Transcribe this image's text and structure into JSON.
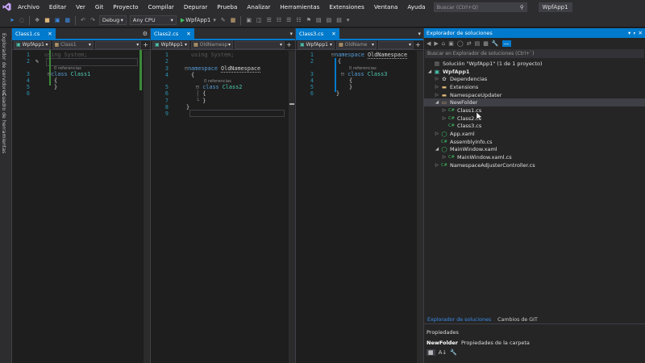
{
  "menu": {
    "items": [
      "Archivo",
      "Editar",
      "Ver",
      "Git",
      "Proyecto",
      "Compilar",
      "Depurar",
      "Prueba",
      "Analizar",
      "Herramientas",
      "Extensiones",
      "Ventana",
      "Ayuda"
    ],
    "search_placeholder": "Buscar (Ctrl+Q)",
    "app_title": "WpfApp1"
  },
  "toolbar": {
    "config": "Debug",
    "platform": "Any CPU",
    "run_target": "WpfApp1"
  },
  "left_strip": {
    "items": [
      "Explorador de servidores",
      "Cuadro de herramientas"
    ]
  },
  "editors": [
    {
      "tab": "Class1.cs",
      "project": "WpfApp1",
      "member": "Class1",
      "lines": [
        {
          "n": "1",
          "code": "using System;"
        },
        {
          "n": "2",
          "code": ""
        },
        {
          "n": "3",
          "ref": "0 referencias",
          "code": "class Class1"
        },
        {
          "n": "4",
          "code": "{"
        },
        {
          "n": "5",
          "code": "}"
        },
        {
          "n": "6",
          "code": ""
        }
      ]
    },
    {
      "tab": "Class2.cs",
      "project": "WpfApp1",
      "member": "OldNamesp",
      "lines": [
        {
          "n": "1",
          "code": "using System;"
        },
        {
          "n": "2",
          "code": ""
        },
        {
          "n": "3",
          "code": "namespace OldNamespace"
        },
        {
          "n": "4",
          "code": "{"
        },
        {
          "n": "5",
          "ref": "0 referencias",
          "code": "class Class2"
        },
        {
          "n": "6",
          "code": "{"
        },
        {
          "n": "7",
          "code": "}"
        },
        {
          "n": "8",
          "code": "}"
        },
        {
          "n": "9",
          "code": ""
        }
      ]
    },
    {
      "tab": "Class3.cs",
      "project": "WpfApp1",
      "member": "OldName",
      "lines": [
        {
          "n": "1",
          "code": "namespace OldNamespace"
        },
        {
          "n": "2",
          "code": "{"
        },
        {
          "n": "3",
          "ref": "0 referencias",
          "code": "class Class3"
        },
        {
          "n": "4",
          "code": "{"
        },
        {
          "n": "5",
          "code": "}"
        },
        {
          "n": "6",
          "code": "}"
        }
      ]
    }
  ],
  "solution_explorer": {
    "title": "Explorador de soluciones",
    "search_placeholder": "Buscar en Explorador de soluciones (Ctrl+`)",
    "tree": [
      {
        "label": "Solución \"WpfApp1\" (1 de 1 proyecto)",
        "depth": 0,
        "icon": "solution-icon",
        "exp": ""
      },
      {
        "label": "WpfApp1",
        "depth": 0,
        "icon": "csproj-icon",
        "exp": "open",
        "bold": true
      },
      {
        "label": "Dependencias",
        "depth": 1,
        "icon": "dependencies-icon",
        "exp": "closed"
      },
      {
        "label": "Extensions",
        "depth": 1,
        "icon": "folder-icon",
        "exp": "closed"
      },
      {
        "label": "NamespaceUpdater",
        "depth": 1,
        "icon": "folder-icon",
        "exp": "closed"
      },
      {
        "label": "NewFolder",
        "depth": 1,
        "icon": "folder-open-icon",
        "exp": "open",
        "selected": true
      },
      {
        "label": "Class1.cs",
        "depth": 2,
        "icon": "csharp-file-icon",
        "exp": "closed"
      },
      {
        "label": "Class2.cs",
        "depth": 2,
        "icon": "csharp-file-icon",
        "exp": "closed"
      },
      {
        "label": "Class3.cs",
        "depth": 2,
        "icon": "csharp-file-icon",
        "exp": ""
      },
      {
        "label": "App.xaml",
        "depth": 1,
        "icon": "xaml-file-icon",
        "exp": "closed"
      },
      {
        "label": "AssemblyInfo.cs",
        "depth": 1,
        "icon": "csharp-file-icon",
        "exp": ""
      },
      {
        "label": "MainWindow.xaml",
        "depth": 1,
        "icon": "xaml-file-icon",
        "exp": "open"
      },
      {
        "label": "MainWindow.xaml.cs",
        "depth": 2,
        "icon": "csharp-file-icon",
        "exp": "closed"
      },
      {
        "label": "NamespaceAdjusterController.cs",
        "depth": 1,
        "icon": "csharp-file-icon",
        "exp": "closed"
      }
    ],
    "tabs": [
      "Explorador de soluciones",
      "Cambios de GIT"
    ]
  },
  "properties": {
    "title": "Propiedades",
    "item": "NewFolder",
    "description": "Propiedades de la carpeta"
  },
  "colors": {
    "accent": "#007acc",
    "keyword": "#569cd6",
    "type": "#4ec9b0",
    "linenum": "#2b91af"
  }
}
